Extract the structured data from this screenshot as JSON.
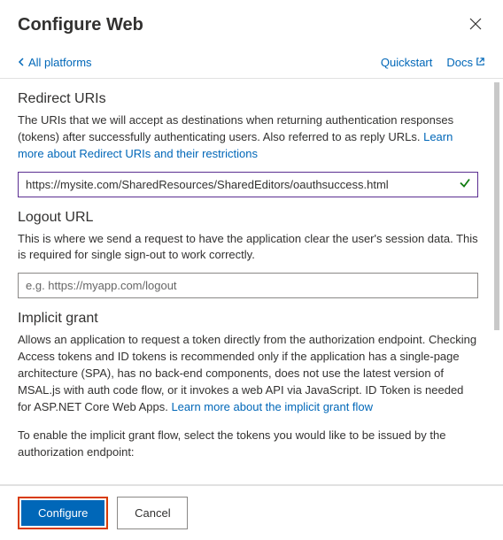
{
  "header": {
    "title": "Configure Web"
  },
  "topbar": {
    "back_label": "All platforms",
    "quickstart_label": "Quickstart",
    "docs_label": "Docs"
  },
  "redirect": {
    "title": "Redirect URIs",
    "desc_part1": "The URIs that we will accept as destinations when returning authentication responses (tokens) after successfully authenticating users. Also referred to as reply URLs. ",
    "link": "Learn more about Redirect URIs and their restrictions",
    "input_value": "https://mysite.com/SharedResources/SharedEditors/oauthsuccess.html"
  },
  "logout": {
    "title": "Logout URL",
    "desc": "This is where we send a request to have the application clear the user's session data. This is required for single sign-out to work correctly.",
    "placeholder": "e.g. https://myapp.com/logout"
  },
  "implicit": {
    "title": "Implicit grant",
    "desc_part1": "Allows an application to request a token directly from the authorization endpoint. Checking Access tokens and ID tokens is recommended only if the application has a single-page architecture (SPA), has no back-end components, does not use the latest version of MSAL.js with auth code flow, or it invokes a web API via JavaScript. ID Token is needed for ASP.NET Core Web Apps. ",
    "link": "Learn more about the implicit grant flow",
    "desc2": "To enable the implicit grant flow, select the tokens you would like to be issued by the authorization endpoint:"
  },
  "footer": {
    "configure_label": "Configure",
    "cancel_label": "Cancel"
  }
}
